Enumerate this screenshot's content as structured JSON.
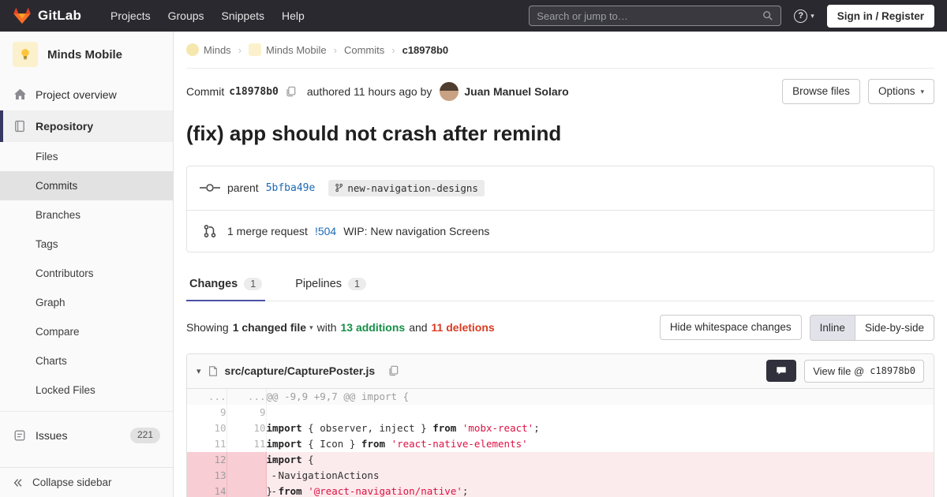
{
  "colors": {
    "navbar_bg": "#29292f",
    "accent_indigo": "#4b51a3",
    "link_blue": "#1b69b6",
    "additions_green": "#168f48",
    "deletions_red": "#db3b21",
    "deletion_row_bg": "#fcebed",
    "string_red": "#dd1144"
  },
  "navbar": {
    "logo_text": "GitLab",
    "items": [
      "Projects",
      "Groups",
      "Snippets",
      "Help"
    ],
    "search_placeholder": "Search or jump to…",
    "sign_in_label": "Sign in / Register"
  },
  "sidebar": {
    "project_name": "Minds Mobile",
    "overview_label": "Project overview",
    "repository_label": "Repository",
    "repo_submenu": [
      "Files",
      "Commits",
      "Branches",
      "Tags",
      "Contributors",
      "Graph",
      "Compare",
      "Charts",
      "Locked Files"
    ],
    "active_submenu_item": "Commits",
    "issues_label": "Issues",
    "issues_count": "221",
    "collapse_label": "Collapse sidebar"
  },
  "breadcrumbs": {
    "group_label": "Minds",
    "project_label": "Minds Mobile",
    "section_label": "Commits",
    "current_sha": "c18978b0"
  },
  "commit": {
    "commit_label": "Commit",
    "sha": "c18978b0",
    "authored_text": "authored 11 hours ago by",
    "author_name": "Juan Manuel Solaro",
    "browse_files_label": "Browse files",
    "options_label": "Options",
    "title": "(fix) app should not crash after remind",
    "parent_label": "parent",
    "parent_sha": "5bfba49e",
    "branch_name": "new-navigation-designs",
    "merge_request_count_text": "1 merge request",
    "merge_request_ref": "!504",
    "merge_request_title": "WIP: New navigation Screens"
  },
  "tabs": {
    "changes_label": "Changes",
    "changes_count": "1",
    "pipelines_label": "Pipelines",
    "pipelines_count": "1"
  },
  "summary": {
    "showing": "Showing",
    "changed_files": "1 changed file",
    "with": "with",
    "additions": "13 additions",
    "and": "and",
    "deletions": "11 deletions",
    "hide_whitespace_label": "Hide whitespace changes",
    "inline_label": "Inline",
    "side_by_side_label": "Side-by-side"
  },
  "diff": {
    "file_path": "src/capture/CapturePoster.js",
    "view_file_prefix": "View file @",
    "view_file_sha": "c18978b0",
    "rows": [
      {
        "type": "hunk",
        "old": "...",
        "new": "...",
        "prefix": "",
        "segments": [
          {
            "text": "@@ -9,9 +9,7 @@ import {",
            "cls": ""
          }
        ]
      },
      {
        "type": "context",
        "old": "9",
        "new": "9",
        "prefix": "",
        "segments": [
          {
            "text": "",
            "cls": ""
          }
        ]
      },
      {
        "type": "context",
        "old": "10",
        "new": "10",
        "prefix": "",
        "segments": [
          {
            "text": "import",
            "cls": "k"
          },
          {
            "text": " { observer, inject } ",
            "cls": ""
          },
          {
            "text": "from",
            "cls": "k"
          },
          {
            "text": " ",
            "cls": ""
          },
          {
            "text": "'mobx-react'",
            "cls": "s"
          },
          {
            "text": ";",
            "cls": ""
          }
        ]
      },
      {
        "type": "context",
        "old": "11",
        "new": "11",
        "prefix": "",
        "segments": [
          {
            "text": "import",
            "cls": "k"
          },
          {
            "text": " { Icon } ",
            "cls": ""
          },
          {
            "text": "from",
            "cls": "k"
          },
          {
            "text": " ",
            "cls": ""
          },
          {
            "text": "'react-native-elements'",
            "cls": "s"
          }
        ]
      },
      {
        "type": "deletion",
        "old": "12",
        "new": "",
        "prefix": "-",
        "segments": [
          {
            "text": "import",
            "cls": "k"
          },
          {
            "text": " {",
            "cls": ""
          }
        ]
      },
      {
        "type": "deletion",
        "old": "13",
        "new": "",
        "prefix": "-",
        "segments": [
          {
            "text": "  NavigationActions",
            "cls": ""
          }
        ]
      },
      {
        "type": "deletion",
        "old": "14",
        "new": "",
        "prefix": "-",
        "segments": [
          {
            "text": "} ",
            "cls": ""
          },
          {
            "text": "from",
            "cls": "k"
          },
          {
            "text": " ",
            "cls": ""
          },
          {
            "text": "'@react-navigation/native'",
            "cls": "s"
          },
          {
            "text": ";",
            "cls": ""
          }
        ]
      }
    ]
  }
}
